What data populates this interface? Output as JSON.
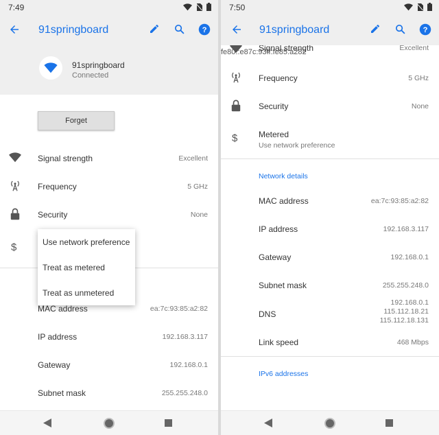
{
  "left": {
    "status_time": "7:49",
    "title": "91springboard",
    "network_name": "91springboard",
    "network_status": "Connected",
    "forget_label": "Forget",
    "rows": [
      {
        "label": "Signal strength",
        "value": "Excellent"
      },
      {
        "label": "Frequency",
        "value": "5 GHz"
      },
      {
        "label": "Security",
        "value": "None"
      },
      {
        "label": "MAC address",
        "value": "ea:7c:93:85:a2:82"
      },
      {
        "label": "IP address",
        "value": "192.168.3.117"
      },
      {
        "label": "Gateway",
        "value": "192.168.0.1"
      },
      {
        "label": "Subnet mask",
        "value": "255.255.248.0"
      }
    ],
    "metered_options": [
      "Use network preference",
      "Treat as metered",
      "Treat as unmetered"
    ]
  },
  "right": {
    "status_time": "7:50",
    "title": "91springboard",
    "rows_top": [
      {
        "label": "Signal strength",
        "value": "Excellent"
      },
      {
        "label": "Frequency",
        "value": "5 GHz"
      },
      {
        "label": "Security",
        "value": "None"
      }
    ],
    "metered": {
      "label": "Metered",
      "sub": "Use network preference"
    },
    "network_details_header": "Network details",
    "details": [
      {
        "label": "MAC address",
        "value": "ea:7c:93:85:a2:82"
      },
      {
        "label": "IP address",
        "value": "192.168.3.117"
      },
      {
        "label": "Gateway",
        "value": "192.168.0.1"
      },
      {
        "label": "Subnet mask",
        "value": "255.255.248.0"
      },
      {
        "label": "DNS",
        "values": [
          "192.168.0.1",
          "115.112.18.21",
          "115.112.18.131"
        ]
      },
      {
        "label": "Link speed",
        "value": "468 Mbps"
      }
    ],
    "ipv6_header": "IPv6 addresses",
    "ipv6_value": "fe80::e87c:93ff:fe85:a282"
  },
  "icons": [
    "back-arrow-icon",
    "edit-icon",
    "search-icon",
    "help-icon",
    "wifi-icon",
    "antenna-icon",
    "lock-icon",
    "dollar-icon",
    "battery-icon",
    "no-sim-icon"
  ],
  "colors": {
    "accent": "#1a73e8",
    "header_bg": "#efefef",
    "text": "#333333",
    "secondary": "#777777"
  }
}
